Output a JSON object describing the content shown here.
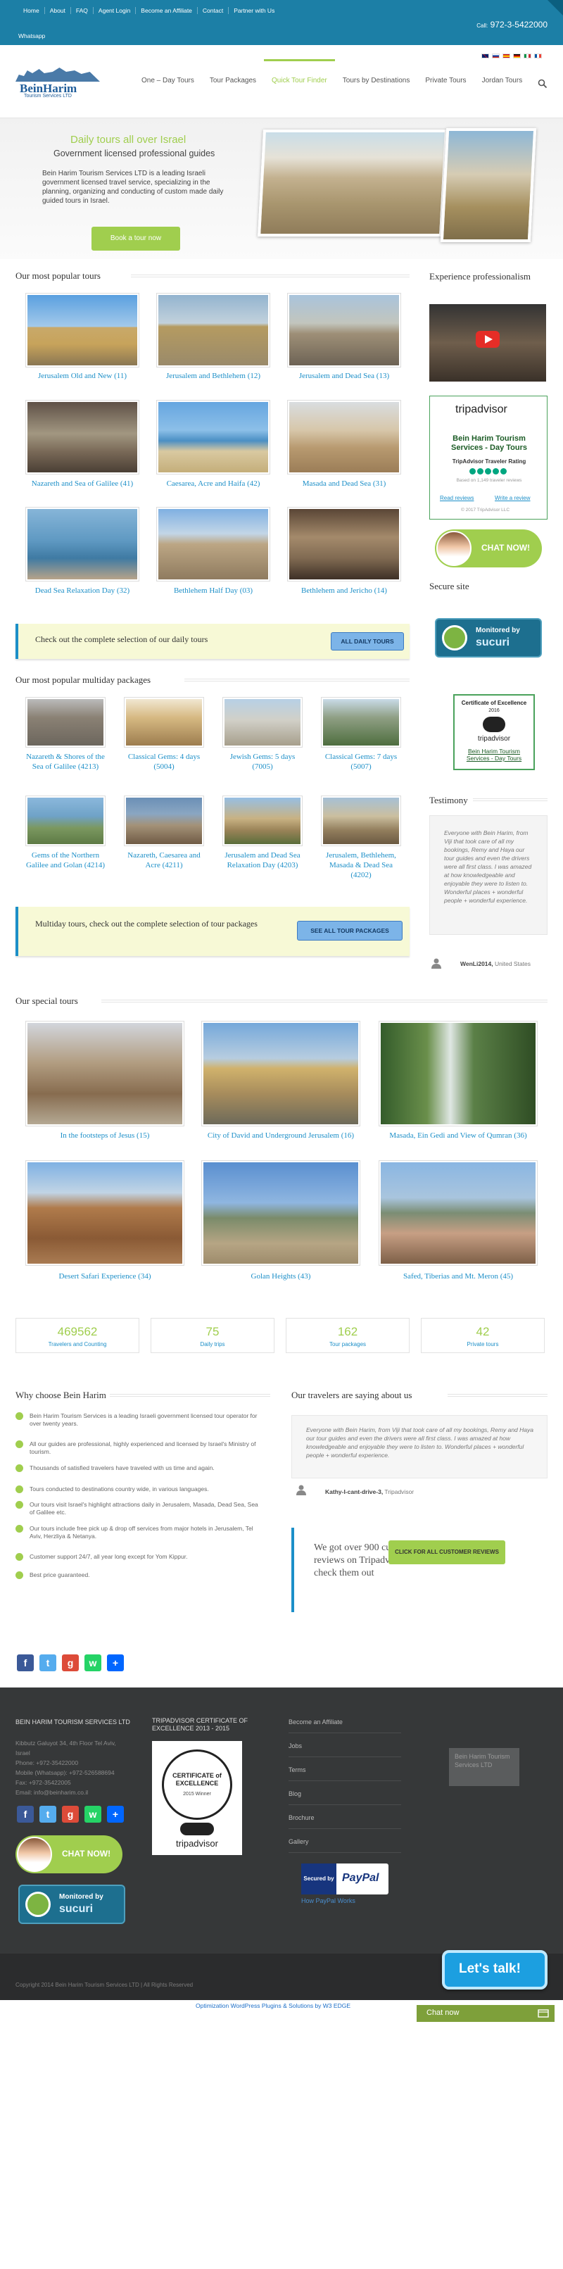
{
  "topbar": {
    "links": [
      "Home",
      "About",
      "FAQ",
      "Agent Login",
      "Become an Affiliate",
      "Contact",
      "Partner with Us"
    ],
    "whatsapp": "Whatsapp",
    "phone_label": "Call:",
    "phone": "972-3-5422000"
  },
  "nav": {
    "logo_title": "BeinHarim",
    "logo_sub": "Tourism Services LTD",
    "items": [
      "One – Day Tours",
      "Tour Packages",
      "Quick Tour Finder",
      "Tours by Destinations",
      "Private Tours",
      "Jordan Tours"
    ],
    "active_index": 2
  },
  "hero": {
    "title": "Daily tours all over Israel",
    "subtitle": "Government licensed professional guides",
    "text": "Bein Harim Tourism Services LTD is a leading Israeli government licensed travel service, specializing in the planning, organizing and conducting of custom made daily guided tours in Israel.",
    "button": "Book a tour now"
  },
  "popular_tours": {
    "title": "Our most popular tours",
    "items": [
      "Jerusalem Old and New (11)",
      "Jerusalem and Bethlehem (12)",
      "Jerusalem and Dead Sea (13)",
      "Nazareth and Sea of Galilee (41)",
      "Caesarea, Acre and Haifa (42)",
      "Masada and Dead Sea (31)",
      "Dead Sea Relaxation Day (32)",
      "Bethlehem Half Day (03)",
      "Bethlehem and Jericho (14)"
    ],
    "cta_text": "Check out the complete selection of our daily tours",
    "cta_button": "ALL DAILY TOURS"
  },
  "multiday": {
    "title": "Our most popular multiday packages",
    "items": [
      "Nazareth & Shores of the Sea of Galilee (4213)",
      "Classical Gems: 4 days (5004)",
      "Jewish Gems: 5 days (7005)",
      "Classical Gems: 7 days (5007)",
      "Gems of the Northern Galilee and Golan (4214)",
      "Nazareth, Caesarea and Acre (4211)",
      "Jerusalem and Dead Sea Relaxation Day (4203)",
      "Jerusalem, Bethlehem, Masada & Dead Sea (4202)"
    ],
    "cta_text": "Multiday tours, check out the complete selection of tour packages",
    "cta_button": "SEE ALL TOUR PACKAGES"
  },
  "special": {
    "title": "Our special tours",
    "items": [
      "In the footsteps of Jesus (15)",
      "City of David and Underground Jerusalem (16)",
      "Masada, Ein Gedi and View of Qumran (36)",
      "Desert Safari Experience (34)",
      "Golan Heights (43)",
      "Safed, Tiberias and Mt. Meron (45)"
    ]
  },
  "counters": [
    {
      "value": "469562",
      "label": "Travelers and Counting"
    },
    {
      "value": "75",
      "label": "Daily trips"
    },
    {
      "value": "162",
      "label": "Tour packages"
    },
    {
      "value": "42",
      "label": "Private tours"
    }
  ],
  "why": {
    "title": "Why choose Bein Harim",
    "items": [
      "Bein Harim Tourism Services is a leading Israeli government licensed tour operator for over twenty years.",
      "All our guides are professional, highly experienced and licensed by Israel's Ministry of tourism.",
      "Thousands of satisfied travelers have traveled with us time and again.",
      "Tours conducted to destinations country wide, in various languages.",
      "Our tours visit Israel's highlight attractions daily in Jerusalem, Masada, Dead Sea, Sea of Galilee etc.",
      "Our tours include free pick up & drop off services from major hotels in Jerusalem, Tel Aviv, Herzliya & Netanya.",
      "Customer support 24/7, all year long except for Yom Kippur.",
      "Best price guaranteed."
    ]
  },
  "travelers": {
    "title": "Our travelers are saying about us",
    "quote": "Everyone with Bein Harim, from Viji that took care of all my bookings, Remy and Haya our tour guides and even the drivers were all first class. I was amazed at how knowledgeable and enjoyable they were to listen to. Wonderful places + wonderful people + wonderful experience.",
    "author": "Kathy-I-cant-drive-3,",
    "source": "Tripadvisor",
    "cta_text": "We got over 900 customer reviews on Tripadvisor, check them out",
    "cta_button": "CLICK FOR ALL CUSTOMER REVIEWS"
  },
  "sidebar": {
    "experience_title": "Experience professionalism",
    "tripadvisor": {
      "logo": "tripadvisor",
      "name": "Bein Harim Tourism Services - Day Tours",
      "rating_label": "TripAdvisor Traveler Rating",
      "reviews": "Based on 1,149 traveler reviews",
      "read_reviews": "Read reviews",
      "write_review": "Write a review",
      "copyright": "© 2017 TripAdvisor LLC"
    },
    "chat": "CHAT NOW!",
    "secure_title": "Secure site",
    "monitored": "Monitored by",
    "sucuri": "sucuri",
    "cert": {
      "title": "Certificate of Excellence",
      "year": "2016",
      "brand": "tripadvisor",
      "name": "Bein Harim Tourism Services - Day Tours"
    },
    "testimony_title": "Testimony",
    "testimony_text": "Everyone with Bein Harim, from Viji that took care of all my bookings, Remy and Haya our tour guides and even the drivers were all first class. I was amazed at how knowledgeable and enjoyable they were to listen to. Wonderful places + wonderful people + wonderful experience.",
    "testimony_author": "WenLi2014,",
    "testimony_place": "United States"
  },
  "footer": {
    "company": "BEIN HARIM TOURISM SERVICES LTD",
    "address": [
      "Kibbutz Galuyot 34, 4th Floor Tel Aviv,",
      "Israel",
      "Phone: +972-35422000",
      "Mobile (Whatsapp): +972-526588694",
      "Fax: +972-35422005",
      "Email: info@beinharim.co.il"
    ],
    "cert_title": "TRIPADVISOR CERTIFICATE OF EXCELLENCE 2013 - 2015",
    "cert_badge": "CERTIFICATE of EXCELLENCE",
    "cert_winner": "2015 Winner",
    "cert_brand": "tripadvisor",
    "links": [
      "Become an Affiliate",
      "Jobs",
      "Terms",
      "Blog",
      "Brochure",
      "Gallery"
    ],
    "paypal_secured": "Secured by",
    "paypal_brand": "PayPal",
    "paypal_link": "How PayPal Works",
    "logo_text": "Bein Harim Tourism Services LTD",
    "chat": "CHAT NOW!",
    "monitored": "Monitored by",
    "sucuri": "sucuri"
  },
  "copyright": "Copyright 2014 Bein Harim Tourism Services LTD | All Rights Reserved",
  "bottom_link": "Optimization WordPress Plugins & Solutions by W3 EDGE",
  "chat_bubble": "Let's talk!",
  "chat_now_bar": "Chat now"
}
